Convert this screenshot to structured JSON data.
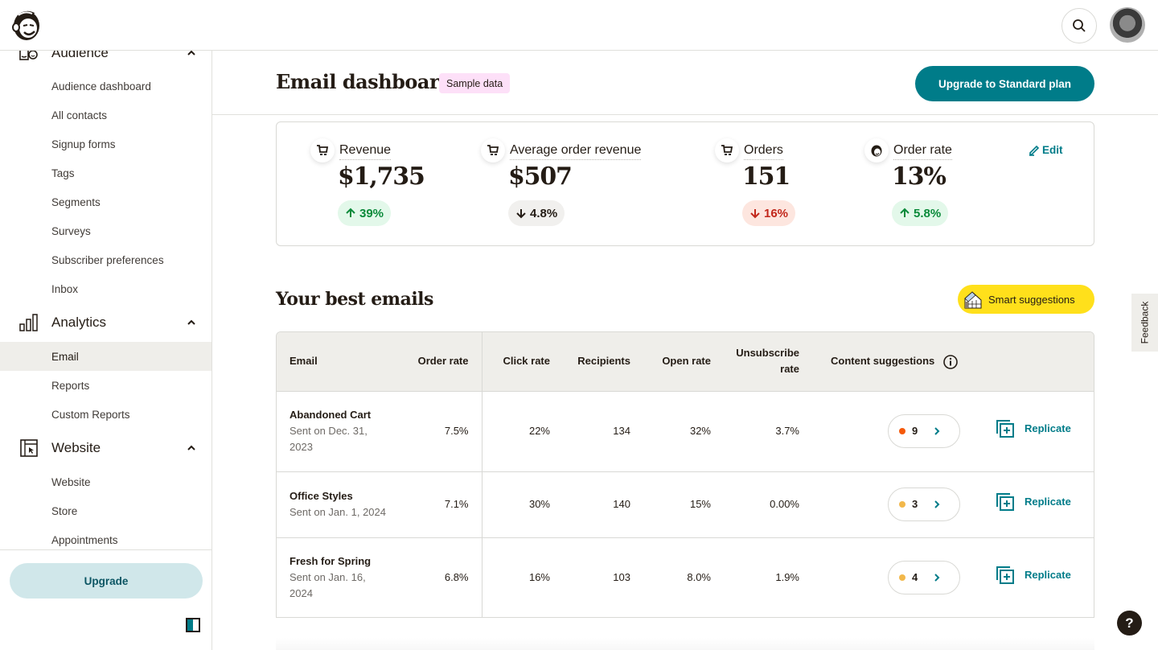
{
  "topbar": {
    "logo_icon": "mailchimp-freddie-logo",
    "search_icon": "search-icon",
    "avatar_icon": "user-avatar"
  },
  "sidebar": {
    "sections": [
      {
        "label": "Audience",
        "icon": "audience-icon",
        "expanded": true,
        "items": [
          {
            "label": "Audience dashboard",
            "active": false
          },
          {
            "label": "All contacts",
            "active": false
          },
          {
            "label": "Signup forms",
            "active": false
          },
          {
            "label": "Tags",
            "active": false
          },
          {
            "label": "Segments",
            "active": false
          },
          {
            "label": "Surveys",
            "active": false
          },
          {
            "label": "Subscriber preferences",
            "active": false
          },
          {
            "label": "Inbox",
            "active": false
          }
        ]
      },
      {
        "label": "Analytics",
        "icon": "analytics-icon",
        "expanded": true,
        "items": [
          {
            "label": "Email",
            "active": true
          },
          {
            "label": "Reports",
            "active": false
          },
          {
            "label": "Custom Reports",
            "active": false
          }
        ]
      },
      {
        "label": "Website",
        "icon": "website-icon",
        "expanded": true,
        "items": [
          {
            "label": "Website",
            "active": false
          },
          {
            "label": "Store",
            "active": false
          },
          {
            "label": "Appointments",
            "active": false
          }
        ]
      }
    ],
    "upgrade_label": "Upgrade"
  },
  "header": {
    "title": "Email dashboard",
    "badge": "Sample data",
    "upgrade_plan_label": "Upgrade to Standard plan"
  },
  "kpis": {
    "edit_label": "Edit",
    "items": [
      {
        "label": "Revenue",
        "value": "$1,735",
        "delta": "39%",
        "direction": "up",
        "icon": "cart-icon"
      },
      {
        "label": "Average order revenue",
        "value": "$507",
        "delta": "4.8%",
        "direction": "down-neutral",
        "icon": "cart-icon"
      },
      {
        "label": "Orders",
        "value": "151",
        "delta": "16%",
        "direction": "down",
        "icon": "cart-icon"
      },
      {
        "label": "Order rate",
        "value": "13%",
        "delta": "5.8%",
        "direction": "up",
        "icon": "freddie-icon"
      }
    ]
  },
  "best_emails": {
    "title": "Your best emails",
    "smart_suggestions_label": "Smart suggestions",
    "columns": [
      "Email",
      "Order rate",
      "Click rate",
      "Recipients",
      "Open rate",
      "Unsubscribe rate",
      "Content suggestions"
    ],
    "rows": [
      {
        "name": "Abandoned Cart",
        "sent": "Sent on Dec. 31, 2023",
        "order_rate": "7.5%",
        "click_rate": "22%",
        "recipients": "134",
        "open_rate": "32%",
        "unsubscribe_rate": "3.7%",
        "suggestions": "9",
        "dot_color": "#f5590a",
        "replicate": "Replicate"
      },
      {
        "name": "Office Styles",
        "sent": "Sent on Jan. 1, 2024",
        "order_rate": "7.1%",
        "click_rate": "30%",
        "recipients": "140",
        "open_rate": "15%",
        "unsubscribe_rate": "0.00%",
        "suggestions": "3",
        "dot_color": "#f2b84b",
        "replicate": "Replicate"
      },
      {
        "name": "Fresh for Spring",
        "sent": "Sent on Jan. 16, 2024",
        "order_rate": "6.8%",
        "click_rate": "16%",
        "recipients": "103",
        "open_rate": "8.0%",
        "unsubscribe_rate": "1.9%",
        "suggestions": "4",
        "dot_color": "#f2b84b",
        "replicate": "Replicate"
      }
    ]
  },
  "feedback_label": "Feedback",
  "help_label": "?",
  "colors": {
    "brand_teal": "#007c89",
    "yellow": "#ffe01b",
    "badge_pink": "#fde0f8",
    "positive": "#0a8a3a",
    "negative": "#c2281c"
  }
}
